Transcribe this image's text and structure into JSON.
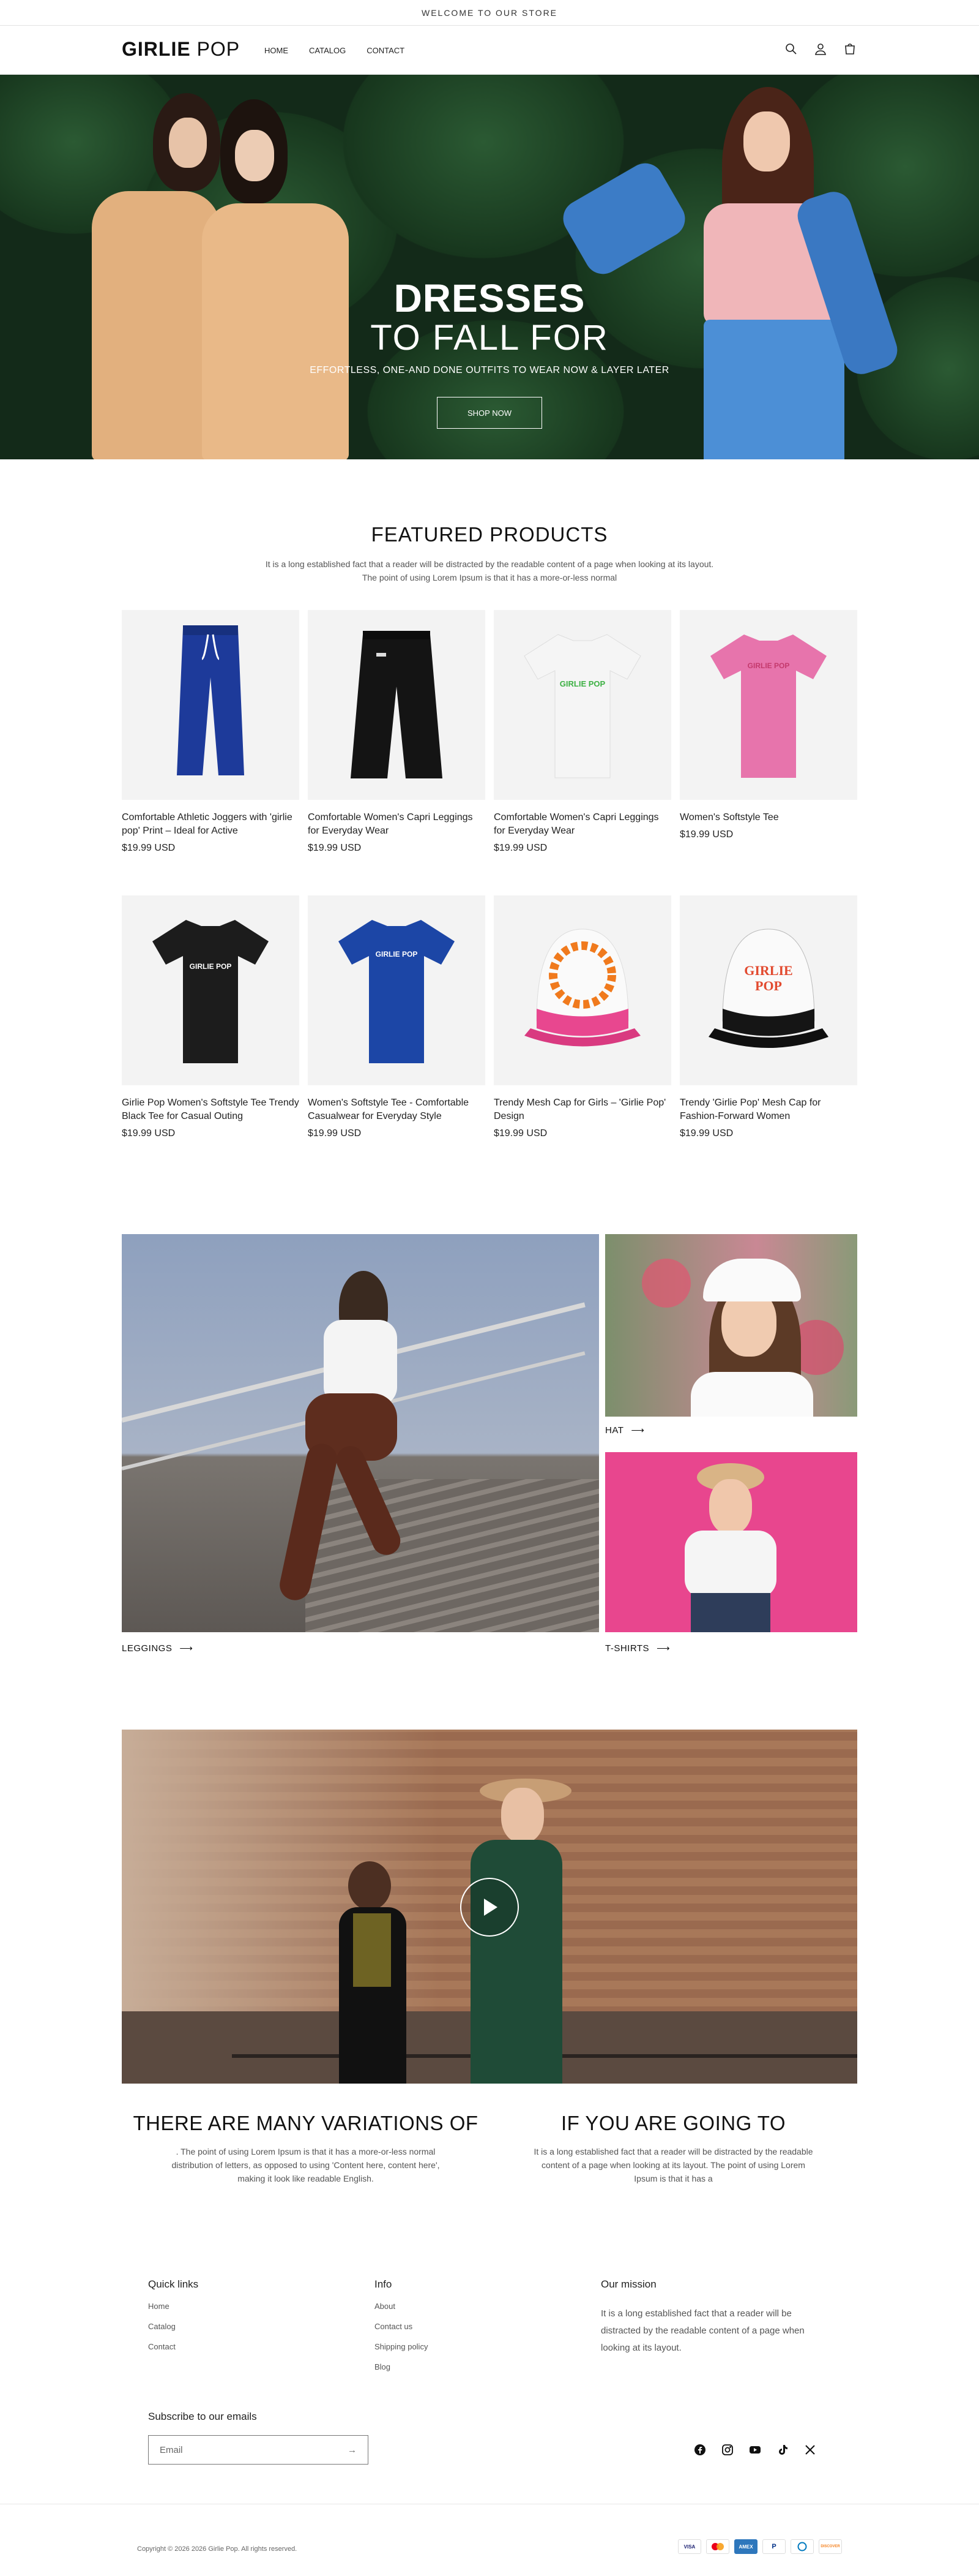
{
  "announcement": "WELCOME TO OUR STORE",
  "header": {
    "logo_bold": "GIRLIE",
    "logo_light": " POP",
    "nav": [
      "HOME",
      "CATALOG",
      "CONTACT"
    ]
  },
  "hero": {
    "title": "DRESSES",
    "subtitle": "TO FALL FOR",
    "tagline": "EFFORTLESS, ONE-AND DONE OUTFITS TO WEAR NOW & LAYER LATER",
    "button": "SHOP NOW"
  },
  "featured": {
    "title": "FEATURED PRODUCTS",
    "description": "It is a long established fact that a reader will be distracted by the readable content of a page when looking at its layout. The point of using Lorem Ipsum is that it has a more-or-less normal",
    "products": [
      {
        "title": "Comfortable Athletic Joggers with 'girlie pop' Print – Ideal for Active",
        "price": "$19.99 USD"
      },
      {
        "title": "Comfortable Women's Capri Leggings for Everyday Wear",
        "price": "$19.99 USD"
      },
      {
        "title": "Comfortable Women's Capri Leggings for Everyday Wear",
        "price": "$19.99 USD"
      },
      {
        "title": "Women's Softstyle Tee",
        "price": "$19.99 USD"
      },
      {
        "title": "Girlie Pop Women's Softstyle Tee Trendy Black Tee for Casual Outing",
        "price": "$19.99 USD"
      },
      {
        "title": "Women's Softstyle Tee - Comfortable Casualwear for Everyday Style",
        "price": "$19.99 USD"
      },
      {
        "title": "Trendy Mesh Cap for Girls – 'Girlie Pop' Design",
        "price": "$19.99 USD"
      },
      {
        "title": "Trendy 'Girlie Pop' Mesh Cap for Fashion-Forward Women",
        "price": "$19.99 USD"
      }
    ],
    "print_text": "GIRLIE POP"
  },
  "collage": {
    "leggings": "LEGGINGS",
    "hat": "HAT",
    "tshirts": "T-SHIRTS"
  },
  "text_columns": [
    {
      "heading": "THERE ARE MANY VARIATIONS OF",
      "body": ". The point of using Lorem Ipsum is that it has a more-or-less normal distribution of letters, as opposed to using 'Content here, content here', making it look like readable English."
    },
    {
      "heading": "IF YOU ARE GOING TO",
      "body": "It is a long established fact that a reader will be distracted by the readable content of a page when looking at its layout. The point of using Lorem Ipsum is that it has a"
    }
  ],
  "footer": {
    "quick_links": {
      "title": "Quick links",
      "items": [
        "Home",
        "Catalog",
        "Contact"
      ]
    },
    "info": {
      "title": "Info",
      "items": [
        "About",
        "Contact us",
        "Shipping policy",
        "Blog"
      ]
    },
    "mission": {
      "title": "Our mission",
      "text": "It is a long established fact that a reader will be distracted by the readable content of a page when looking at its layout."
    },
    "subscribe_title": "Subscribe to our emails",
    "email_placeholder": "Email",
    "copyright": "Copyright © 2026 2026 Girlie Pop. All rights reserved.",
    "payments": [
      "VISA",
      "MC",
      "AMEX",
      "PayPal",
      "Diners",
      "DISCOVER"
    ]
  },
  "colors": {
    "accent": "#111111",
    "hero_bg": "#132a19",
    "card_bg": "#f3f3f3",
    "pink": "#e8478f"
  }
}
